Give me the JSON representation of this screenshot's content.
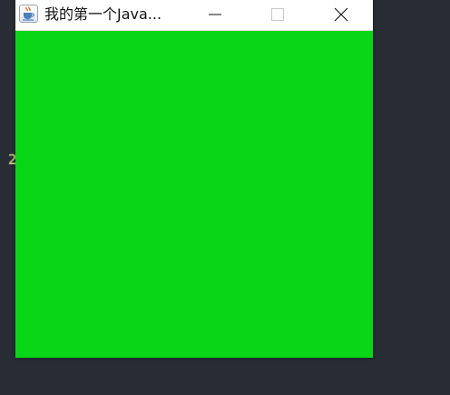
{
  "background": {
    "color": "#282c34",
    "editor_fragment": "2",
    "editor_text_color": "#b0b87a"
  },
  "window": {
    "title": "我的第一个Java...",
    "app_icon": "java-cup-icon",
    "controls": {
      "minimize_icon": "minimize-icon",
      "maximize_icon": "maximize-icon",
      "close_icon": "close-icon"
    },
    "content_color": "#09d616"
  }
}
